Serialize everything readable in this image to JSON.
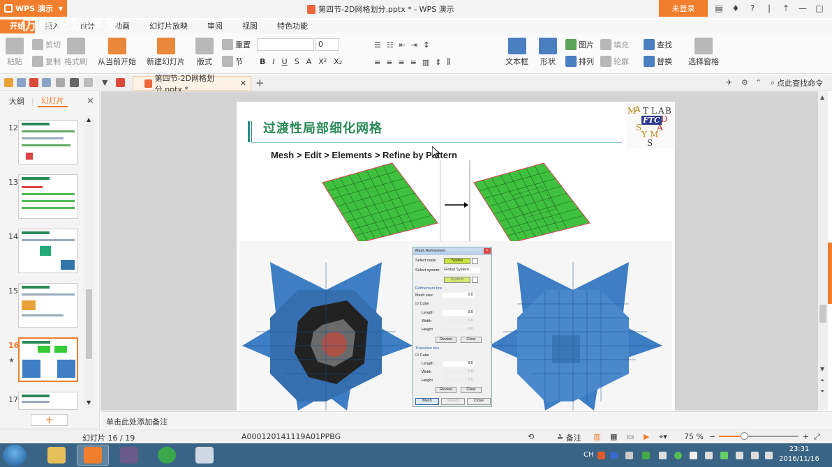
{
  "app": {
    "name": "WPS 演示",
    "window_title": "第四节-2D网格划分.pptx * - WPS 演示",
    "login_label": "未登录"
  },
  "window_controls": [
    "?",
    "—",
    "□",
    "✕"
  ],
  "watermark": "仿真论坛学堂",
  "ribbon": {
    "tabs": [
      {
        "label": "开始",
        "active": true
      },
      {
        "label": "插入"
      },
      {
        "label": "设计"
      },
      {
        "label": "动画"
      },
      {
        "label": "幻灯片放映"
      },
      {
        "label": "审阅"
      },
      {
        "label": "视图"
      },
      {
        "label": "特色功能"
      }
    ],
    "clipboard": {
      "paste": "粘贴",
      "cut": "剪切",
      "copy": "复制",
      "format_painter": "格式刷"
    },
    "slides": {
      "from_current": "从当前开始",
      "new_slide": "新建幻灯片",
      "layout": "版式",
      "reset": "重置",
      "section": "节"
    },
    "font": {
      "name": "",
      "size": "0"
    },
    "format": {
      "bold": "B",
      "italic": "I",
      "underline": "U",
      "shadow": "S",
      "strike": "A",
      "superscript": "X²",
      "subscript": "X₂"
    },
    "drawing": {
      "textbox": "文本框",
      "shape": "形状",
      "picture": "图片",
      "fill": "填充",
      "arrange": "排列",
      "outline": "轮廓"
    },
    "editing": {
      "find": "查找",
      "replace": "替换",
      "select_pane": "选择窗格"
    }
  },
  "doc_tab": {
    "label": "第四节-2D网格划分.pptx *",
    "close": "✕"
  },
  "search_commands": "点此查找命令",
  "left_panel": {
    "tabs": [
      {
        "label": "大纲",
        "active": false
      },
      {
        "label": "幻灯片",
        "active": true
      }
    ],
    "close": "✕",
    "slides": [
      {
        "num": "12"
      },
      {
        "num": "13"
      },
      {
        "num": "14"
      },
      {
        "num": "15"
      },
      {
        "num": "16",
        "active": true
      },
      {
        "num": "17"
      }
    ],
    "add_button": "+"
  },
  "slide": {
    "title": "过渡性局部细化网格",
    "path": "Mesh > Edit > Elements > Refine by Pattern",
    "logo": {
      "letters": [
        "M",
        "A",
        "T",
        "L",
        "A",
        "B",
        "S",
        "Y",
        "M",
        "S",
        "D",
        "A"
      ],
      "ftc": "FTC"
    },
    "dialog": {
      "title": "Mesh Refinement",
      "select_node_label": "Select node:",
      "nodes_btn": "Nodes",
      "select_system_label": "Select system:",
      "system_value": "Global System",
      "system_btn": "System",
      "refinement_box": "Refinement box",
      "mesh_size_label": "Mesh size:",
      "mesh_size_value": "0.0",
      "cube_label": "Cube",
      "length_label": "Length",
      "length_value": "0.0",
      "width_label": "Width",
      "width_value": "0.0",
      "height_label": "Height",
      "height_value": "0.0",
      "review_btn": "Review",
      "clear_btn": "Clear",
      "transition_box": "Transition box",
      "cube2_label": "Cube",
      "length2_value": "0.0",
      "width2_value": "0.0",
      "height2_value": "0.0",
      "review2_btn": "Review",
      "clear2_btn": "Clear",
      "mesh_btn": "Mesh",
      "reject_btn": "Reject",
      "close_btn": "Close"
    }
  },
  "notes_placeholder": "单击此处添加备注",
  "status_bar": {
    "slide_counter": "幻灯片 16 / 19",
    "template": "A000120141119A01PPBG",
    "notes": "备注",
    "zoom": "75 %",
    "zoom_fraction": 0.32
  },
  "taskbar": {
    "lang": "CH",
    "time": "23:31",
    "date": "2016/11/16"
  },
  "colors": {
    "accent": "#f07e2c",
    "mesh_green": "#3fc03f",
    "mesh_blue": "#3d7ec4",
    "title_green": "#2a8a58"
  }
}
